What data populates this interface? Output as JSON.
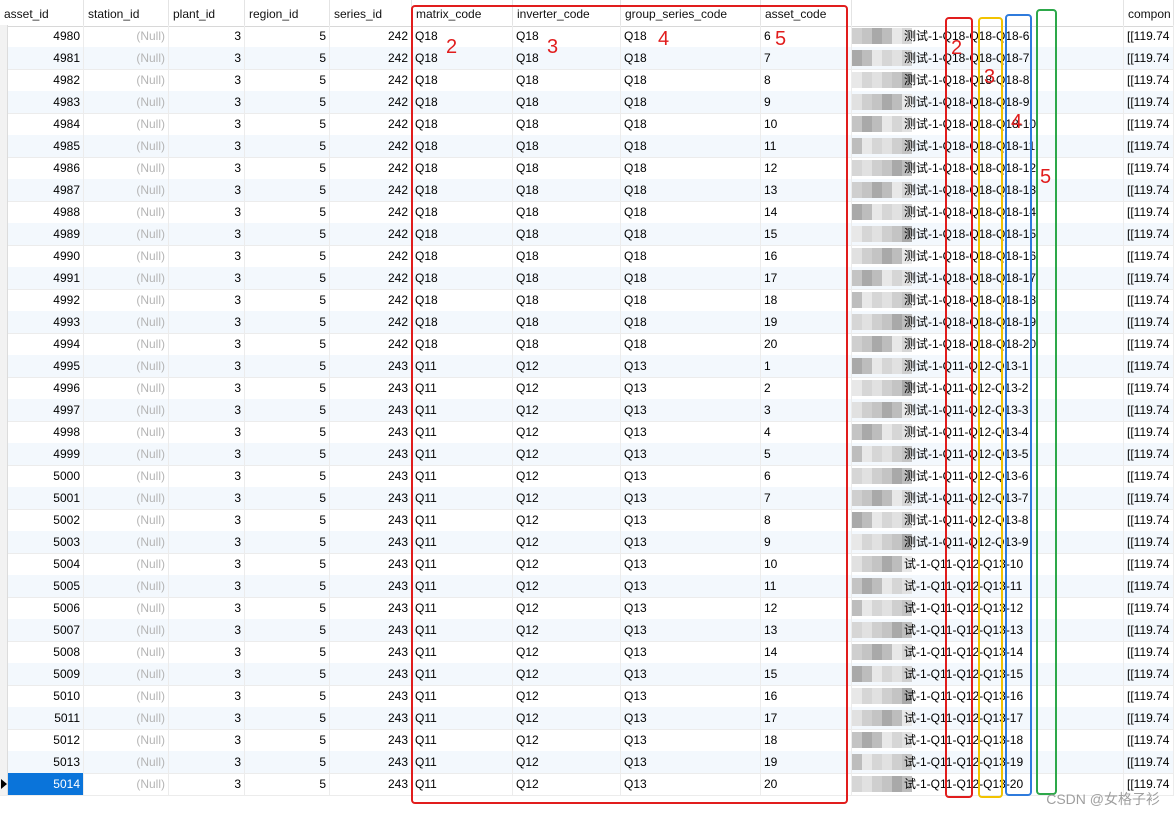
{
  "columns": [
    {
      "key": "asset_id",
      "label": "asset_id"
    },
    {
      "key": "station_id",
      "label": "station_id"
    },
    {
      "key": "plant_id",
      "label": "plant_id"
    },
    {
      "key": "region_id",
      "label": "region_id"
    },
    {
      "key": "series_id",
      "label": "series_id"
    },
    {
      "key": "matrix_code",
      "label": "matrix_code"
    },
    {
      "key": "inverter_code",
      "label": "inverter_code"
    },
    {
      "key": "group_series_code",
      "label": "group_series_code"
    },
    {
      "key": "asset_code",
      "label": "asset_code"
    },
    {
      "key": "asset_name",
      "label": ""
    },
    {
      "key": "component",
      "label": "compon"
    }
  ],
  "null_text": "(Null)",
  "rows": [
    {
      "asset_id": "4980",
      "station_id": "(Null)",
      "plant_id": "3",
      "region_id": "5",
      "series_id": "242",
      "matrix_code": "Q18",
      "inverter_code": "Q18",
      "group_series_code": "Q18",
      "asset_code": "6",
      "asset_name": "测试-1-Q18-Q18-Q18-6",
      "component": "[[119.74"
    },
    {
      "asset_id": "4981",
      "station_id": "(Null)",
      "plant_id": "3",
      "region_id": "5",
      "series_id": "242",
      "matrix_code": "Q18",
      "inverter_code": "Q18",
      "group_series_code": "Q18",
      "asset_code": "7",
      "asset_name": "测试-1-Q18-Q18-Q18-7",
      "component": "[[119.74"
    },
    {
      "asset_id": "4982",
      "station_id": "(Null)",
      "plant_id": "3",
      "region_id": "5",
      "series_id": "242",
      "matrix_code": "Q18",
      "inverter_code": "Q18",
      "group_series_code": "Q18",
      "asset_code": "8",
      "asset_name": "测试-1-Q18-Q18-Q18-8",
      "component": "[[119.74"
    },
    {
      "asset_id": "4983",
      "station_id": "(Null)",
      "plant_id": "3",
      "region_id": "5",
      "series_id": "242",
      "matrix_code": "Q18",
      "inverter_code": "Q18",
      "group_series_code": "Q18",
      "asset_code": "9",
      "asset_name": "测试-1-Q18-Q18-Q18-9",
      "component": "[[119.74"
    },
    {
      "asset_id": "4984",
      "station_id": "(Null)",
      "plant_id": "3",
      "region_id": "5",
      "series_id": "242",
      "matrix_code": "Q18",
      "inverter_code": "Q18",
      "group_series_code": "Q18",
      "asset_code": "10",
      "asset_name": "测试-1-Q18-Q18-Q18-10",
      "component": "[[119.74"
    },
    {
      "asset_id": "4985",
      "station_id": "(Null)",
      "plant_id": "3",
      "region_id": "5",
      "series_id": "242",
      "matrix_code": "Q18",
      "inverter_code": "Q18",
      "group_series_code": "Q18",
      "asset_code": "11",
      "asset_name": "测试-1-Q18-Q18-Q18-11",
      "component": "[[119.74"
    },
    {
      "asset_id": "4986",
      "station_id": "(Null)",
      "plant_id": "3",
      "region_id": "5",
      "series_id": "242",
      "matrix_code": "Q18",
      "inverter_code": "Q18",
      "group_series_code": "Q18",
      "asset_code": "12",
      "asset_name": "测试-1-Q18-Q18-Q18-12",
      "component": "[[119.74"
    },
    {
      "asset_id": "4987",
      "station_id": "(Null)",
      "plant_id": "3",
      "region_id": "5",
      "series_id": "242",
      "matrix_code": "Q18",
      "inverter_code": "Q18",
      "group_series_code": "Q18",
      "asset_code": "13",
      "asset_name": "测试-1-Q18-Q18-Q18-13",
      "component": "[[119.74"
    },
    {
      "asset_id": "4988",
      "station_id": "(Null)",
      "plant_id": "3",
      "region_id": "5",
      "series_id": "242",
      "matrix_code": "Q18",
      "inverter_code": "Q18",
      "group_series_code": "Q18",
      "asset_code": "14",
      "asset_name": "测试-1-Q18-Q18-Q18-14",
      "component": "[[119.74"
    },
    {
      "asset_id": "4989",
      "station_id": "(Null)",
      "plant_id": "3",
      "region_id": "5",
      "series_id": "242",
      "matrix_code": "Q18",
      "inverter_code": "Q18",
      "group_series_code": "Q18",
      "asset_code": "15",
      "asset_name": "测试-1-Q18-Q18-Q18-15",
      "component": "[[119.74"
    },
    {
      "asset_id": "4990",
      "station_id": "(Null)",
      "plant_id": "3",
      "region_id": "5",
      "series_id": "242",
      "matrix_code": "Q18",
      "inverter_code": "Q18",
      "group_series_code": "Q18",
      "asset_code": "16",
      "asset_name": "测试-1-Q18-Q18-Q18-16",
      "component": "[[119.74"
    },
    {
      "asset_id": "4991",
      "station_id": "(Null)",
      "plant_id": "3",
      "region_id": "5",
      "series_id": "242",
      "matrix_code": "Q18",
      "inverter_code": "Q18",
      "group_series_code": "Q18",
      "asset_code": "17",
      "asset_name": "测试-1-Q18-Q18-Q18-17",
      "component": "[[119.74"
    },
    {
      "asset_id": "4992",
      "station_id": "(Null)",
      "plant_id": "3",
      "region_id": "5",
      "series_id": "242",
      "matrix_code": "Q18",
      "inverter_code": "Q18",
      "group_series_code": "Q18",
      "asset_code": "18",
      "asset_name": "测试-1-Q18-Q18-Q18-18",
      "component": "[[119.74"
    },
    {
      "asset_id": "4993",
      "station_id": "(Null)",
      "plant_id": "3",
      "region_id": "5",
      "series_id": "242",
      "matrix_code": "Q18",
      "inverter_code": "Q18",
      "group_series_code": "Q18",
      "asset_code": "19",
      "asset_name": "测试-1-Q18-Q18-Q18-19",
      "component": "[[119.74"
    },
    {
      "asset_id": "4994",
      "station_id": "(Null)",
      "plant_id": "3",
      "region_id": "5",
      "series_id": "242",
      "matrix_code": "Q18",
      "inverter_code": "Q18",
      "group_series_code": "Q18",
      "asset_code": "20",
      "asset_name": "测试-1-Q18-Q18-Q18-20",
      "component": "[[119.74"
    },
    {
      "asset_id": "4995",
      "station_id": "(Null)",
      "plant_id": "3",
      "region_id": "5",
      "series_id": "243",
      "matrix_code": "Q11",
      "inverter_code": "Q12",
      "group_series_code": "Q13",
      "asset_code": "1",
      "asset_name": "测试-1-Q11-Q12-Q13-1",
      "component": "[[119.74"
    },
    {
      "asset_id": "4996",
      "station_id": "(Null)",
      "plant_id": "3",
      "region_id": "5",
      "series_id": "243",
      "matrix_code": "Q11",
      "inverter_code": "Q12",
      "group_series_code": "Q13",
      "asset_code": "2",
      "asset_name": "测试-1-Q11-Q12-Q13-2",
      "component": "[[119.74"
    },
    {
      "asset_id": "4997",
      "station_id": "(Null)",
      "plant_id": "3",
      "region_id": "5",
      "series_id": "243",
      "matrix_code": "Q11",
      "inverter_code": "Q12",
      "group_series_code": "Q13",
      "asset_code": "3",
      "asset_name": "测试-1-Q11-Q12-Q13-3",
      "component": "[[119.74"
    },
    {
      "asset_id": "4998",
      "station_id": "(Null)",
      "plant_id": "3",
      "region_id": "5",
      "series_id": "243",
      "matrix_code": "Q11",
      "inverter_code": "Q12",
      "group_series_code": "Q13",
      "asset_code": "4",
      "asset_name": "测试-1-Q11-Q12-Q13-4",
      "component": "[[119.74"
    },
    {
      "asset_id": "4999",
      "station_id": "(Null)",
      "plant_id": "3",
      "region_id": "5",
      "series_id": "243",
      "matrix_code": "Q11",
      "inverter_code": "Q12",
      "group_series_code": "Q13",
      "asset_code": "5",
      "asset_name": "测试-1-Q11-Q12-Q13-5",
      "component": "[[119.74"
    },
    {
      "asset_id": "5000",
      "station_id": "(Null)",
      "plant_id": "3",
      "region_id": "5",
      "series_id": "243",
      "matrix_code": "Q11",
      "inverter_code": "Q12",
      "group_series_code": "Q13",
      "asset_code": "6",
      "asset_name": "测试-1-Q11-Q12-Q13-6",
      "component": "[[119.74"
    },
    {
      "asset_id": "5001",
      "station_id": "(Null)",
      "plant_id": "3",
      "region_id": "5",
      "series_id": "243",
      "matrix_code": "Q11",
      "inverter_code": "Q12",
      "group_series_code": "Q13",
      "asset_code": "7",
      "asset_name": "测试-1-Q11-Q12-Q13-7",
      "component": "[[119.74"
    },
    {
      "asset_id": "5002",
      "station_id": "(Null)",
      "plant_id": "3",
      "region_id": "5",
      "series_id": "243",
      "matrix_code": "Q11",
      "inverter_code": "Q12",
      "group_series_code": "Q13",
      "asset_code": "8",
      "asset_name": "测试-1-Q11-Q12-Q13-8",
      "component": "[[119.74"
    },
    {
      "asset_id": "5003",
      "station_id": "(Null)",
      "plant_id": "3",
      "region_id": "5",
      "series_id": "243",
      "matrix_code": "Q11",
      "inverter_code": "Q12",
      "group_series_code": "Q13",
      "asset_code": "9",
      "asset_name": "测试-1-Q11-Q12-Q13-9",
      "component": "[[119.74"
    },
    {
      "asset_id": "5004",
      "station_id": "(Null)",
      "plant_id": "3",
      "region_id": "5",
      "series_id": "243",
      "matrix_code": "Q11",
      "inverter_code": "Q12",
      "group_series_code": "Q13",
      "asset_code": "10",
      "asset_name": "试-1-Q11-Q12-Q13-10",
      "component": "[[119.74"
    },
    {
      "asset_id": "5005",
      "station_id": "(Null)",
      "plant_id": "3",
      "region_id": "5",
      "series_id": "243",
      "matrix_code": "Q11",
      "inverter_code": "Q12",
      "group_series_code": "Q13",
      "asset_code": "11",
      "asset_name": "试-1-Q11-Q12-Q13-11",
      "component": "[[119.74"
    },
    {
      "asset_id": "5006",
      "station_id": "(Null)",
      "plant_id": "3",
      "region_id": "5",
      "series_id": "243",
      "matrix_code": "Q11",
      "inverter_code": "Q12",
      "group_series_code": "Q13",
      "asset_code": "12",
      "asset_name": "试-1-Q11-Q12-Q13-12",
      "component": "[[119.74"
    },
    {
      "asset_id": "5007",
      "station_id": "(Null)",
      "plant_id": "3",
      "region_id": "5",
      "series_id": "243",
      "matrix_code": "Q11",
      "inverter_code": "Q12",
      "group_series_code": "Q13",
      "asset_code": "13",
      "asset_name": "试-1-Q11-Q12-Q13-13",
      "component": "[[119.74"
    },
    {
      "asset_id": "5008",
      "station_id": "(Null)",
      "plant_id": "3",
      "region_id": "5",
      "series_id": "243",
      "matrix_code": "Q11",
      "inverter_code": "Q12",
      "group_series_code": "Q13",
      "asset_code": "14",
      "asset_name": "试-1-Q11-Q12-Q13-14",
      "component": "[[119.74"
    },
    {
      "asset_id": "5009",
      "station_id": "(Null)",
      "plant_id": "3",
      "region_id": "5",
      "series_id": "243",
      "matrix_code": "Q11",
      "inverter_code": "Q12",
      "group_series_code": "Q13",
      "asset_code": "15",
      "asset_name": "试-1-Q11-Q12-Q13-15",
      "component": "[[119.74"
    },
    {
      "asset_id": "5010",
      "station_id": "(Null)",
      "plant_id": "3",
      "region_id": "5",
      "series_id": "243",
      "matrix_code": "Q11",
      "inverter_code": "Q12",
      "group_series_code": "Q13",
      "asset_code": "16",
      "asset_name": "试-1-Q11-Q12-Q13-16",
      "component": "[[119.74"
    },
    {
      "asset_id": "5011",
      "station_id": "(Null)",
      "plant_id": "3",
      "region_id": "5",
      "series_id": "243",
      "matrix_code": "Q11",
      "inverter_code": "Q12",
      "group_series_code": "Q13",
      "asset_code": "17",
      "asset_name": "试-1-Q11-Q12-Q13-17",
      "component": "[[119.74"
    },
    {
      "asset_id": "5012",
      "station_id": "(Null)",
      "plant_id": "3",
      "region_id": "5",
      "series_id": "243",
      "matrix_code": "Q11",
      "inverter_code": "Q12",
      "group_series_code": "Q13",
      "asset_code": "18",
      "asset_name": "试-1-Q11-Q12-Q13-18",
      "component": "[[119.74"
    },
    {
      "asset_id": "5013",
      "station_id": "(Null)",
      "plant_id": "3",
      "region_id": "5",
      "series_id": "243",
      "matrix_code": "Q11",
      "inverter_code": "Q12",
      "group_series_code": "Q13",
      "asset_code": "19",
      "asset_name": "试-1-Q11-Q12-Q13-19",
      "component": "[[119.74"
    },
    {
      "asset_id": "5014",
      "station_id": "(Null)",
      "plant_id": "3",
      "region_id": "5",
      "series_id": "243",
      "matrix_code": "Q11",
      "inverter_code": "Q12",
      "group_series_code": "Q13",
      "asset_code": "20",
      "asset_name": "试-1-Q11-Q12-Q13-20",
      "component": "[[119.74"
    }
  ],
  "selected_asset_id": "5014",
  "annotations": {
    "left_labels": [
      "2",
      "3",
      "4",
      "5"
    ],
    "right_labels": [
      "2",
      "3",
      "4",
      "5"
    ],
    "colors": {
      "red": "#e11d1d",
      "yellow": "#f2c300",
      "blue": "#2f7bdc",
      "green": "#2da84a"
    }
  },
  "watermark": "CSDN @女格子衫"
}
